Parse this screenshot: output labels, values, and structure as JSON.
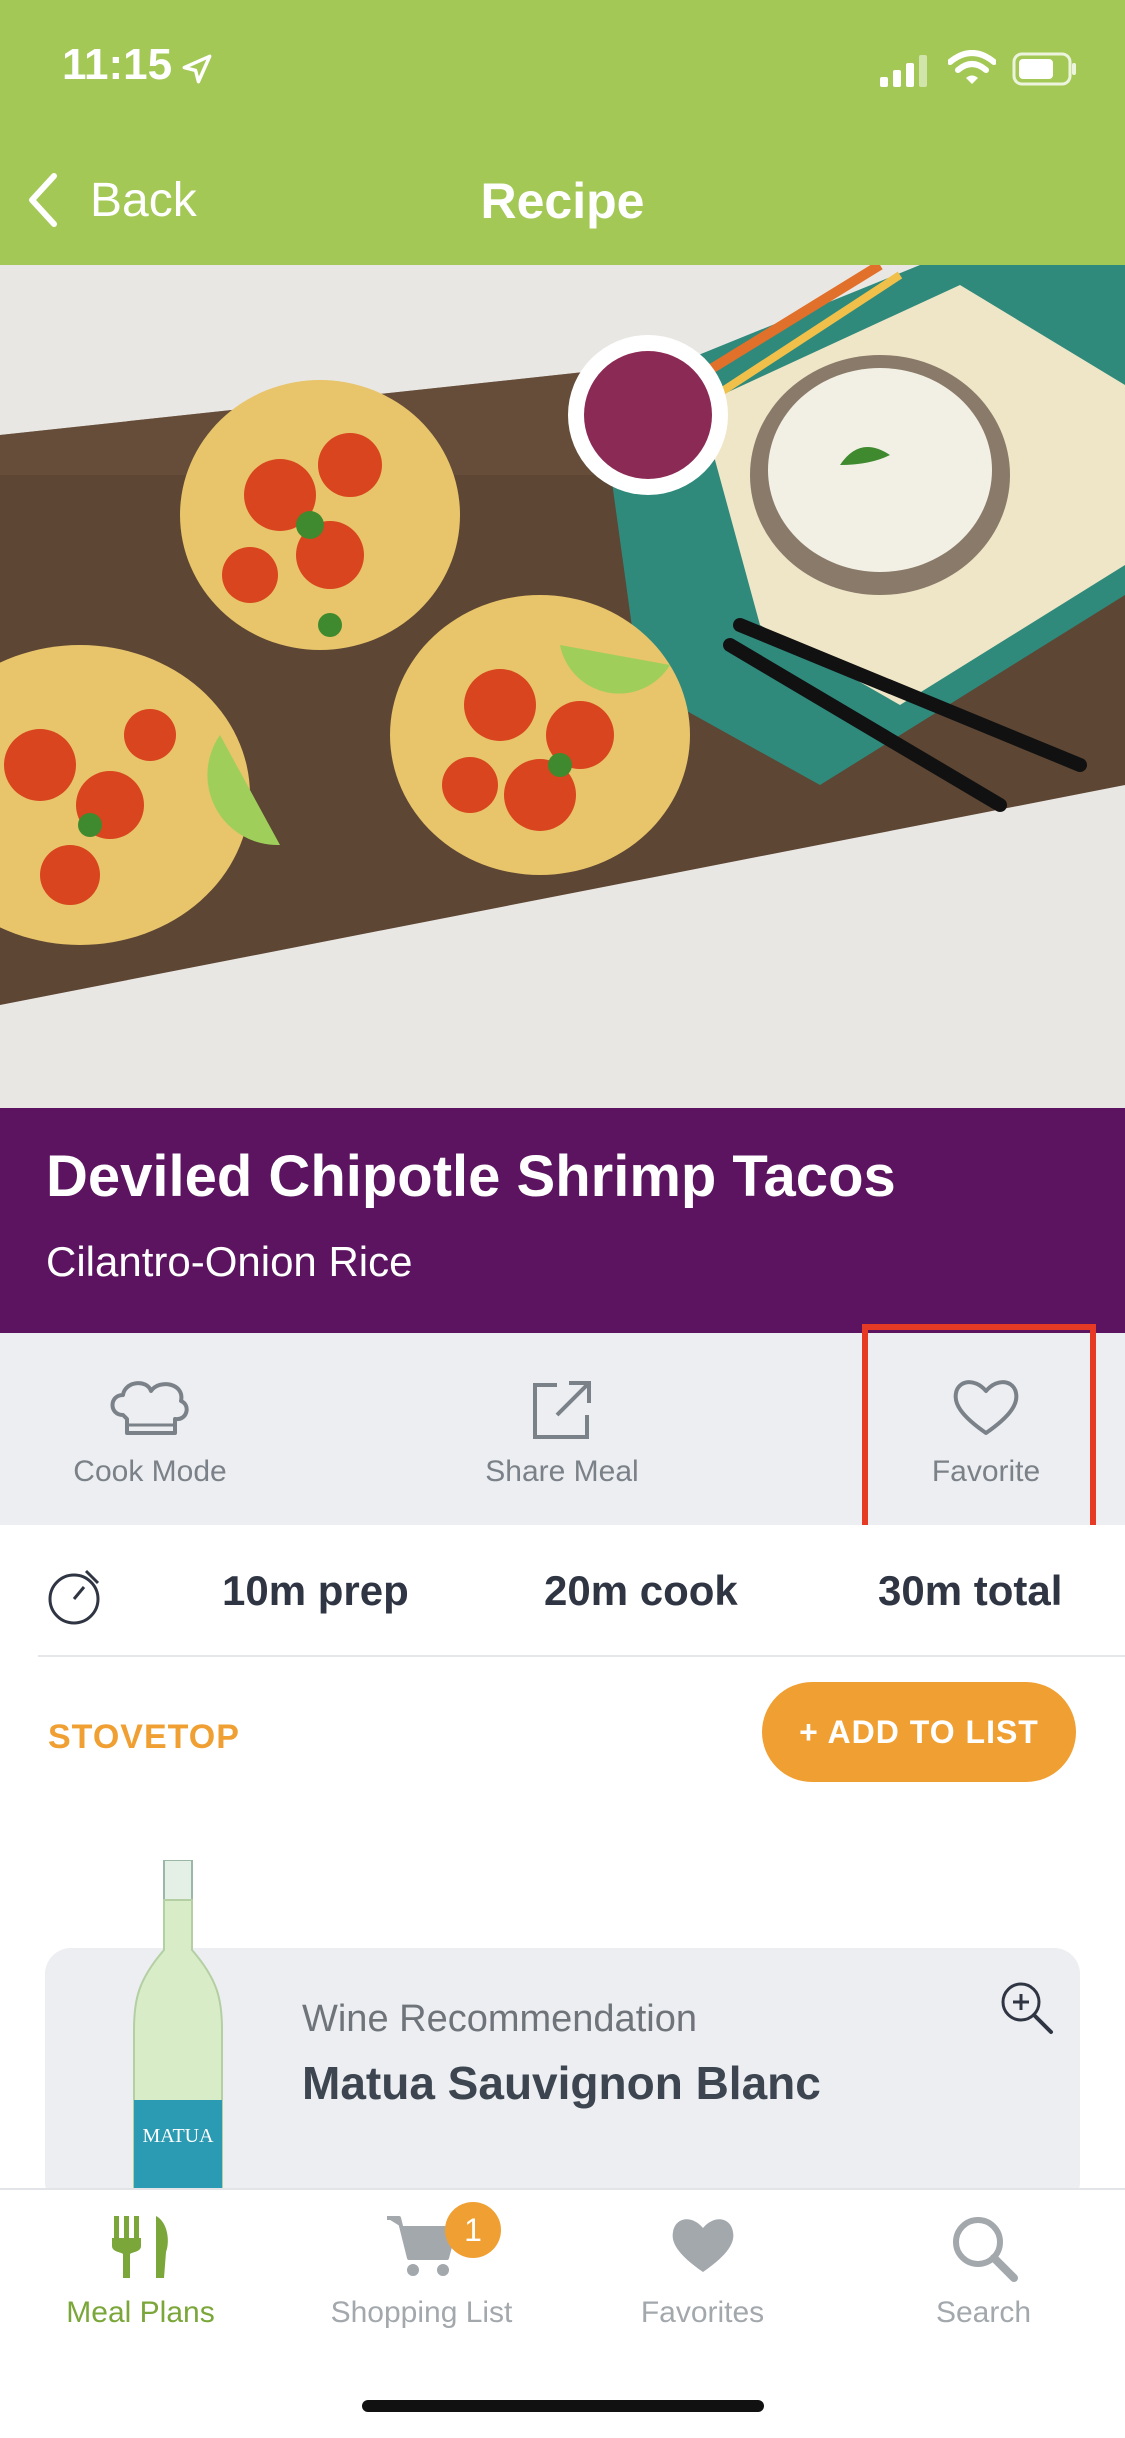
{
  "status_bar": {
    "time": "11:15"
  },
  "nav": {
    "back_label": "Back",
    "title": "Recipe"
  },
  "hero": {
    "alt": "Shrimp tacos on a wooden board with rice and lime"
  },
  "recipe": {
    "title": "Deviled Chipotle Shrimp Tacos",
    "subtitle": "Cilantro-Onion Rice"
  },
  "actions": [
    {
      "label": "Cook Mode",
      "icon": "chef-hat-icon"
    },
    {
      "label": "Share Meal",
      "icon": "share-icon"
    },
    {
      "label": "Favorite",
      "icon": "heart-outline-icon"
    }
  ],
  "times": {
    "prep": "10m prep",
    "cook": "20m cook",
    "total": "30m total"
  },
  "method": "STOVETOP",
  "add_to_list": "+ ADD TO LIST",
  "wine": {
    "kicker": "Wine Recommendation",
    "name": "Matua Sauvignon Blanc",
    "bottle_label": "MATUA"
  },
  "tabs": [
    {
      "label": "Meal Plans",
      "icon": "fork-knife-icon",
      "active": true
    },
    {
      "label": "Shopping List",
      "icon": "cart-icon",
      "badge": "1"
    },
    {
      "label": "Favorites",
      "icon": "heart-icon"
    },
    {
      "label": "Search",
      "icon": "search-icon"
    }
  ],
  "colors": {
    "header_green": "#a3c855",
    "title_purple": "#5c1460",
    "accent_orange": "#f0a033",
    "highlight_red": "#e63a24"
  }
}
